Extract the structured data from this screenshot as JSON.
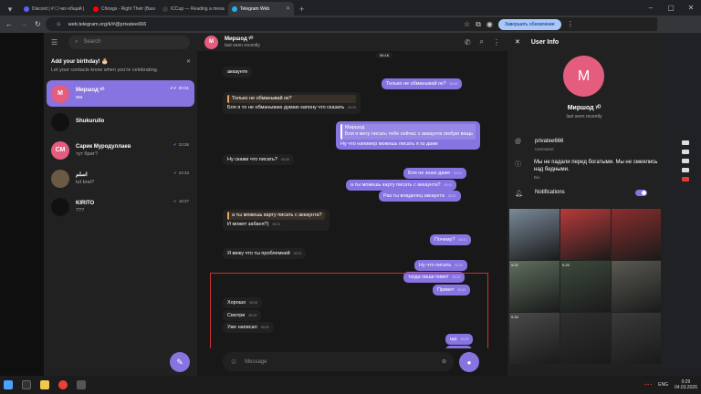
{
  "browser": {
    "tabs": [
      {
        "label": "Discord | #🗨чат-общий | ICCup...",
        "color": "#5865f2",
        "active": false
      },
      {
        "label": "Chirags - Right Their (Bass Boost)",
        "color": "#ff0000",
        "active": false
      },
      {
        "label": "ICCup — Reading a message from...",
        "color": "#3a3a3a",
        "active": false
      },
      {
        "label": "Telegram Web",
        "color": "#2aabee",
        "active": true
      }
    ],
    "url": "web.telegram.org/k/#@privatee666",
    "update_button": "Завершить обновление"
  },
  "sidebar": {
    "search_placeholder": "Search",
    "birthday_title": "Add your birthday! 🎂",
    "birthday_text": "Let your contacts know when you're celebrating.",
    "chats": [
      {
        "initials": "M",
        "name": "Миршод ᵞᴰ",
        "message": "wa",
        "time": "00:31",
        "color": "#e45d7e",
        "selected": true,
        "check": "✔✔"
      },
      {
        "initials": "",
        "name": "Shukurullo",
        "message": "",
        "time": "",
        "color": "#111111",
        "selected": false,
        "check": ""
      },
      {
        "initials": "СМ",
        "name": "Сарик Муродуллаев",
        "message": "тут брат?",
        "time": "23:36",
        "color": "#e45d7e",
        "selected": false,
        "check": "✔"
      },
      {
        "initials": "",
        "name": "اسلم",
        "message": "tut brat?",
        "time": "23:33",
        "color": "#6b5a43",
        "selected": false,
        "check": "✔"
      },
      {
        "initials": "",
        "name": "KIRITO",
        "message": "???",
        "time": "18:37",
        "color": "#111111",
        "selected": false,
        "check": "✔"
      }
    ]
  },
  "conversation": {
    "header_initials": "M",
    "name": "Миршод ᵞᴰ",
    "status": "last seen recently",
    "date_chip": "00:16",
    "composer_placeholder": "Message",
    "messages": [
      {
        "dir": "in",
        "text": "аккаунте",
        "time": "",
        "quote": ""
      },
      {
        "dir": "out",
        "text": "Только не обманывай ок?",
        "time": "00:19",
        "quote": ""
      },
      {
        "dir": "in",
        "text": "Бля я то не обманываю думаю капону что сказать",
        "time": "00:20",
        "quote": "Только не обманывай ок?"
      },
      {
        "dir": "out",
        "text": "Ну что напимер можешь писать я хз даже",
        "time": "",
        "quote": "Миршод\nБля я могу писать тебе сейчас с аккаунта любую вещь"
      },
      {
        "dir": "in",
        "text": "Ну скажи что писать?",
        "time": "00:20",
        "quote": ""
      },
      {
        "dir": "out",
        "text": "Бля не знаю даже",
        "time": "00:21",
        "quote": ""
      },
      {
        "dir": "out",
        "text": "а ты можешь карту писать с аккаунта?",
        "time": "00:21",
        "quote": ""
      },
      {
        "dir": "out",
        "text": "Раз ты владелец аккаунта",
        "time": "00:21",
        "quote": ""
      },
      {
        "dir": "in",
        "text": "И может забаня?)",
        "time": "00:21",
        "quote": "а ты можешь карту писать с аккаунта?"
      },
      {
        "dir": "out",
        "text": "Почему?",
        "time": "00:22",
        "quote": ""
      },
      {
        "dir": "in",
        "text": "Я вижу что ты проблемний",
        "time": "00:22",
        "quote": ""
      },
      {
        "dir": "out",
        "text": "Ну что писать",
        "time": "00:22",
        "quote": ""
      },
      {
        "dir": "out",
        "text": "тогда пиши пивет",
        "time": "00:22",
        "quote": ""
      },
      {
        "dir": "out",
        "text": "Привет",
        "time": "00:22",
        "quote": ""
      },
      {
        "dir": "in",
        "text": "Хорошо",
        "time": "00:23",
        "quote": ""
      },
      {
        "dir": "in",
        "text": "Смотри",
        "time": "00:23",
        "quote": ""
      },
      {
        "dir": "in",
        "text": "Уже написал",
        "time": "00:23",
        "quote": ""
      },
      {
        "dir": "out",
        "text": "ща",
        "time": "00:23",
        "quote": ""
      },
      {
        "dir": "out",
        "text": "++",
        "time": "00:24",
        "quote": ""
      },
      {
        "dir": "out",
        "text": "wa",
        "time": "00:31",
        "quote": ""
      }
    ]
  },
  "user_info": {
    "title": "User Info",
    "initials": "M",
    "name": "Миршод ᵞᴰ",
    "status": "last seen recently",
    "username": "privatee666",
    "username_label": "Username",
    "bio": "Мы не падали перед богатыми. Мы не смеялись над бедными.",
    "bio_label": "Bio",
    "notifications_label": "Notifications",
    "notifications_on": true,
    "media": [
      {
        "label": "",
        "color": "#7a8a9a"
      },
      {
        "label": "",
        "color": "#b83a3a"
      },
      {
        "label": "",
        "color": "#8a2e2e"
      },
      {
        "label": "0:22",
        "color": "#5f6f5f"
      },
      {
        "label": "0:29",
        "color": "#3d4a3d"
      },
      {
        "label": "",
        "color": "#5a5a52"
      },
      {
        "label": "0:16",
        "color": "#4a4a4a"
      },
      {
        "label": "",
        "color": "#2f2f2f"
      },
      {
        "label": "",
        "color": "#3a3a3a"
      }
    ]
  },
  "taskbar": {
    "lang": "ENG",
    "time": "0:29",
    "date": "04.03.2026"
  }
}
